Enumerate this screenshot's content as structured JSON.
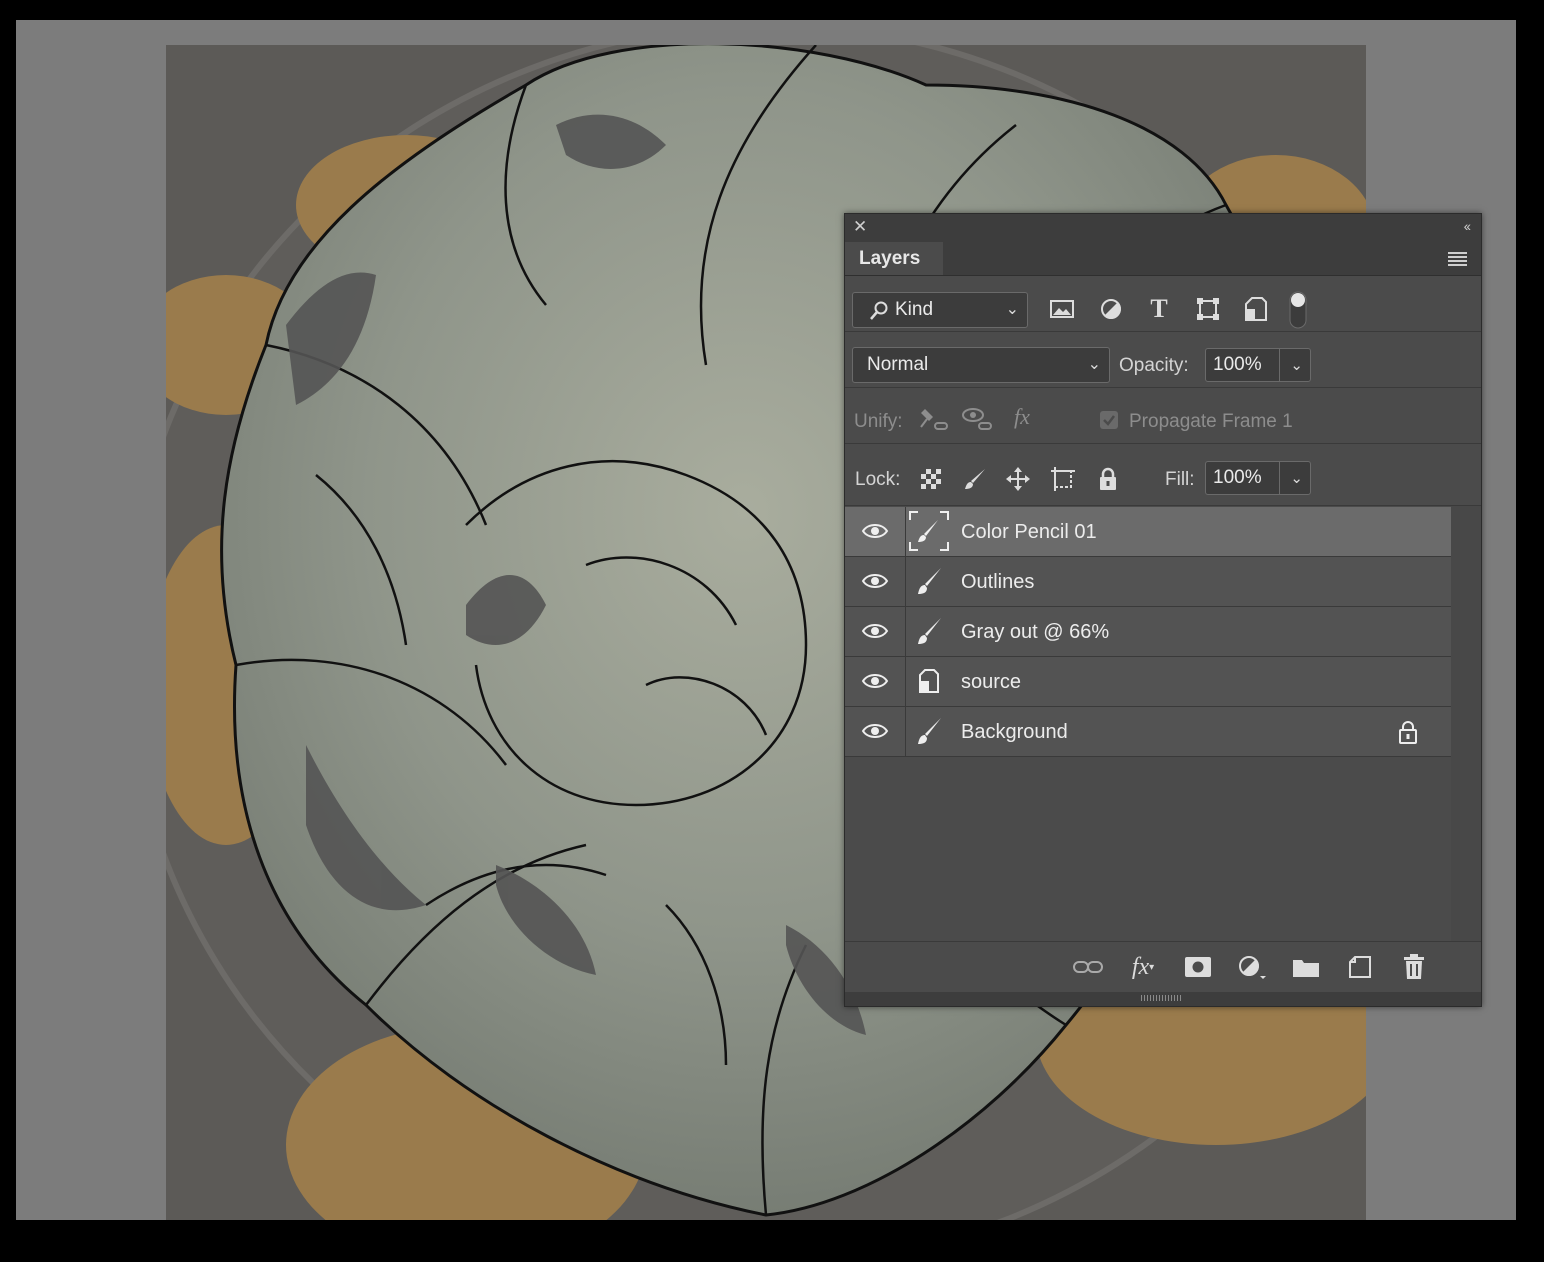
{
  "panel": {
    "tab_label": "Layers",
    "filter": {
      "label": "Kind",
      "icons": [
        "image-filter-icon",
        "adjustment-filter-icon",
        "type-filter-icon",
        "shape-filter-icon",
        "smart-object-filter-icon",
        "filter-toggle-icon"
      ]
    },
    "blend_mode": "Normal",
    "opacity_label": "Opacity:",
    "opacity_value": "100%",
    "unify_label": "Unify:",
    "propagate_label": "Propagate Frame 1",
    "lock_label": "Lock:",
    "fill_label": "Fill:",
    "fill_value": "100%"
  },
  "layers": [
    {
      "name": "Color Pencil 01",
      "selected": true,
      "visible": true,
      "thumb": "brush-icon",
      "locked": false
    },
    {
      "name": "Outlines",
      "selected": false,
      "visible": true,
      "thumb": "brush-icon",
      "locked": false
    },
    {
      "name": "Gray out @ 66%",
      "selected": false,
      "visible": true,
      "thumb": "brush-icon",
      "locked": false
    },
    {
      "name": "source",
      "selected": false,
      "visible": true,
      "thumb": "smart-object-icon",
      "locked": false
    },
    {
      "name": "Background",
      "selected": false,
      "visible": true,
      "thumb": "brush-icon",
      "locked": true
    }
  ],
  "footer_icons": [
    "link-layers-icon",
    "fx-icon",
    "layer-mask-icon",
    "adjustment-layer-icon",
    "group-folder-icon",
    "new-layer-icon",
    "trash-icon"
  ],
  "colors": {
    "workspace": "#7c7c7c",
    "panel": "#4b4b4b",
    "selected_row": "#6b6b6b"
  }
}
